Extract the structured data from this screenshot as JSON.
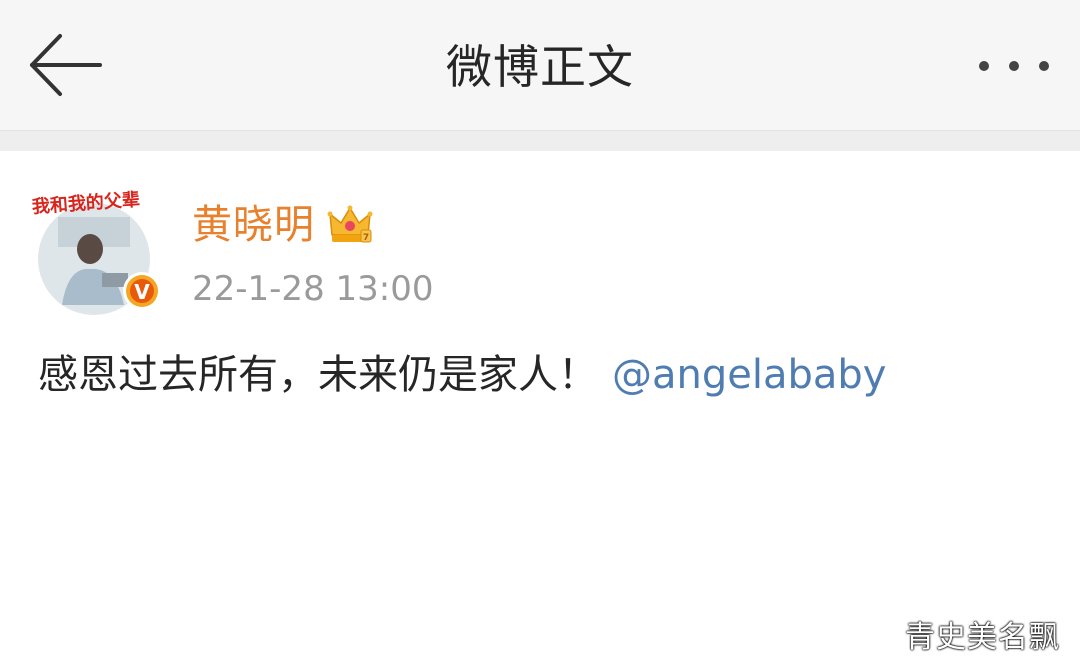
{
  "header": {
    "title": "微博正文",
    "back_icon": "arrow-left-icon",
    "more_icon": "more-dots-icon"
  },
  "post": {
    "author": {
      "name": "黄晓明",
      "avatar_caption": "我和我的父辈",
      "verified_badge_letter": "V",
      "badge_icon": "crown-icon"
    },
    "timestamp": "22-1-28 13:00",
    "text": "感恩过去所有，未来仍是家人！",
    "mention": "@angelababy"
  },
  "watermark": "青史美名飘",
  "colors": {
    "username": "#e8802c",
    "mention": "#4f7db1",
    "timestamp": "#9a9a9a",
    "header_bg": "#f6f6f6",
    "verified_badge": "#f5a623"
  }
}
